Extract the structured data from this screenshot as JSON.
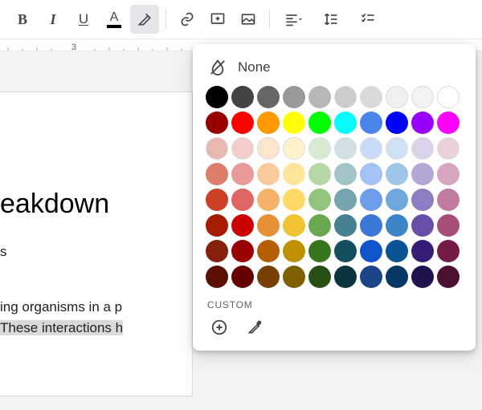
{
  "toolbar": {
    "bold": "B",
    "italic": "I",
    "underline": "U",
    "textcolor_letter": "A"
  },
  "ruler": {
    "number": "3"
  },
  "document": {
    "title_fragment": "eakdown",
    "subtitle_fragment": "s",
    "body_line1_fragment": "ing organisms in a p",
    "body_line2_highlight": "These interactions h"
  },
  "picker": {
    "none_label": "None",
    "custom_label": "CUSTOM",
    "rows": [
      [
        "#000000",
        "#434343",
        "#666666",
        "#999999",
        "#b7b7b7",
        "#cccccc",
        "#d9d9d9",
        "#efefef",
        "#f3f3f3",
        "#ffffff"
      ],
      [
        "#980000",
        "#ff0000",
        "#ff9900",
        "#ffff00",
        "#00ff00",
        "#00ffff",
        "#4a86e8",
        "#0000ff",
        "#9900ff",
        "#ff00ff"
      ],
      [
        "#e6b8af",
        "#f4cccc",
        "#fce5cd",
        "#fff2cc",
        "#d9ead3",
        "#d0e0e3",
        "#c9daf8",
        "#cfe2f3",
        "#d9d2e9",
        "#ead1dc"
      ],
      [
        "#dd7e6b",
        "#ea9999",
        "#f9cb9c",
        "#ffe599",
        "#b6d7a8",
        "#a2c4c9",
        "#a4c2f4",
        "#9fc5e8",
        "#b4a7d6",
        "#d5a6bd"
      ],
      [
        "#cc4125",
        "#e06666",
        "#f6b26b",
        "#ffd966",
        "#93c47d",
        "#76a5af",
        "#6d9eeb",
        "#6fa8dc",
        "#8e7cc3",
        "#c27ba0"
      ],
      [
        "#a61c00",
        "#cc0000",
        "#e69138",
        "#f1c232",
        "#6aa84f",
        "#45818e",
        "#3c78d8",
        "#3d85c6",
        "#674ea7",
        "#a64d79"
      ],
      [
        "#85200c",
        "#990000",
        "#b45f06",
        "#bf9000",
        "#38761d",
        "#134f5c",
        "#1155cc",
        "#0b5394",
        "#351c75",
        "#741b47"
      ],
      [
        "#5b0f00",
        "#660000",
        "#783f04",
        "#7f6000",
        "#274e13",
        "#0c343d",
        "#1c4587",
        "#073763",
        "#20124d",
        "#4c1130"
      ]
    ]
  }
}
